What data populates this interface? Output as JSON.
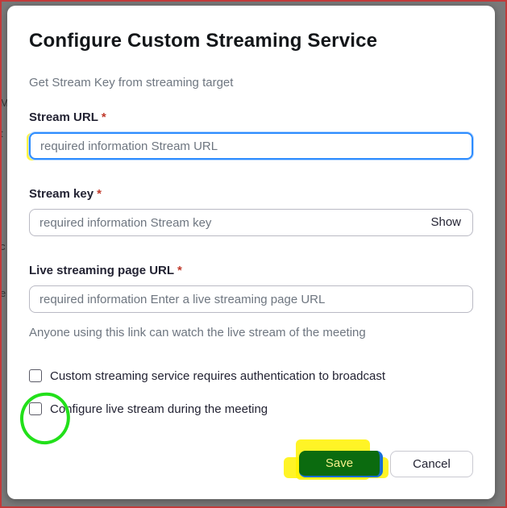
{
  "background": {
    "fragments": [
      "'",
      "M",
      "t",
      "c",
      "e"
    ]
  },
  "dialog": {
    "title": "Configure Custom Streaming Service",
    "subtitle": "Get Stream Key from streaming target",
    "stream_url": {
      "label": "Stream URL",
      "required_mark": "*",
      "placeholder": "required information Stream URL",
      "value": ""
    },
    "stream_key": {
      "label": "Stream key",
      "required_mark": "*",
      "placeholder": "required information Stream key",
      "value": "",
      "show_label": "Show"
    },
    "live_page_url": {
      "label": "Live streaming page URL",
      "required_mark": "*",
      "placeholder": "required information Enter a live streaming page URL",
      "value": "",
      "helper": "Anyone using this link can watch the live stream of the meeting"
    },
    "checkboxes": [
      {
        "label": "Custom streaming service requires authentication to broadcast",
        "checked": false
      },
      {
        "label": "Configure live stream during the meeting",
        "checked": false
      }
    ],
    "buttons": {
      "save": "Save",
      "cancel": "Cancel"
    }
  },
  "colors": {
    "highlight_yellow": "#fff200",
    "annotation_green": "#22e01a",
    "focus_blue": "#2d8cff",
    "save_bg": "#0b6b0f",
    "required_red": "#c0392b"
  }
}
